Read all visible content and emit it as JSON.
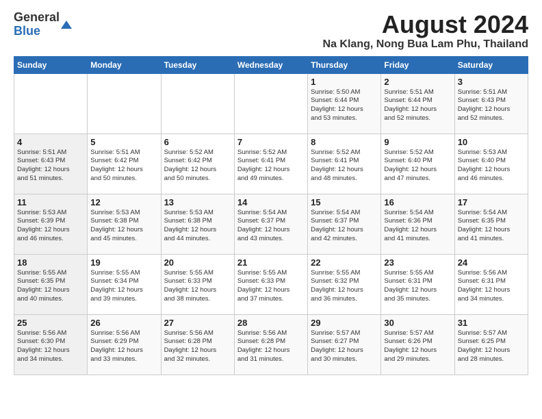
{
  "logo": {
    "general": "General",
    "blue": "Blue"
  },
  "title": "August 2024",
  "location": "Na Klang, Nong Bua Lam Phu, Thailand",
  "days_of_week": [
    "Sunday",
    "Monday",
    "Tuesday",
    "Wednesday",
    "Thursday",
    "Friday",
    "Saturday"
  ],
  "weeks": [
    [
      {
        "day": "",
        "info": ""
      },
      {
        "day": "",
        "info": ""
      },
      {
        "day": "",
        "info": ""
      },
      {
        "day": "",
        "info": ""
      },
      {
        "day": "1",
        "info": "Sunrise: 5:50 AM\nSunset: 6:44 PM\nDaylight: 12 hours\nand 53 minutes."
      },
      {
        "day": "2",
        "info": "Sunrise: 5:51 AM\nSunset: 6:44 PM\nDaylight: 12 hours\nand 52 minutes."
      },
      {
        "day": "3",
        "info": "Sunrise: 5:51 AM\nSunset: 6:43 PM\nDaylight: 12 hours\nand 52 minutes."
      }
    ],
    [
      {
        "day": "4",
        "info": "Sunrise: 5:51 AM\nSunset: 6:43 PM\nDaylight: 12 hours\nand 51 minutes."
      },
      {
        "day": "5",
        "info": "Sunrise: 5:51 AM\nSunset: 6:42 PM\nDaylight: 12 hours\nand 50 minutes."
      },
      {
        "day": "6",
        "info": "Sunrise: 5:52 AM\nSunset: 6:42 PM\nDaylight: 12 hours\nand 50 minutes."
      },
      {
        "day": "7",
        "info": "Sunrise: 5:52 AM\nSunset: 6:41 PM\nDaylight: 12 hours\nand 49 minutes."
      },
      {
        "day": "8",
        "info": "Sunrise: 5:52 AM\nSunset: 6:41 PM\nDaylight: 12 hours\nand 48 minutes."
      },
      {
        "day": "9",
        "info": "Sunrise: 5:52 AM\nSunset: 6:40 PM\nDaylight: 12 hours\nand 47 minutes."
      },
      {
        "day": "10",
        "info": "Sunrise: 5:53 AM\nSunset: 6:40 PM\nDaylight: 12 hours\nand 46 minutes."
      }
    ],
    [
      {
        "day": "11",
        "info": "Sunrise: 5:53 AM\nSunset: 6:39 PM\nDaylight: 12 hours\nand 46 minutes."
      },
      {
        "day": "12",
        "info": "Sunrise: 5:53 AM\nSunset: 6:38 PM\nDaylight: 12 hours\nand 45 minutes."
      },
      {
        "day": "13",
        "info": "Sunrise: 5:53 AM\nSunset: 6:38 PM\nDaylight: 12 hours\nand 44 minutes."
      },
      {
        "day": "14",
        "info": "Sunrise: 5:54 AM\nSunset: 6:37 PM\nDaylight: 12 hours\nand 43 minutes."
      },
      {
        "day": "15",
        "info": "Sunrise: 5:54 AM\nSunset: 6:37 PM\nDaylight: 12 hours\nand 42 minutes."
      },
      {
        "day": "16",
        "info": "Sunrise: 5:54 AM\nSunset: 6:36 PM\nDaylight: 12 hours\nand 41 minutes."
      },
      {
        "day": "17",
        "info": "Sunrise: 5:54 AM\nSunset: 6:35 PM\nDaylight: 12 hours\nand 41 minutes."
      }
    ],
    [
      {
        "day": "18",
        "info": "Sunrise: 5:55 AM\nSunset: 6:35 PM\nDaylight: 12 hours\nand 40 minutes."
      },
      {
        "day": "19",
        "info": "Sunrise: 5:55 AM\nSunset: 6:34 PM\nDaylight: 12 hours\nand 39 minutes."
      },
      {
        "day": "20",
        "info": "Sunrise: 5:55 AM\nSunset: 6:33 PM\nDaylight: 12 hours\nand 38 minutes."
      },
      {
        "day": "21",
        "info": "Sunrise: 5:55 AM\nSunset: 6:33 PM\nDaylight: 12 hours\nand 37 minutes."
      },
      {
        "day": "22",
        "info": "Sunrise: 5:55 AM\nSunset: 6:32 PM\nDaylight: 12 hours\nand 36 minutes."
      },
      {
        "day": "23",
        "info": "Sunrise: 5:55 AM\nSunset: 6:31 PM\nDaylight: 12 hours\nand 35 minutes."
      },
      {
        "day": "24",
        "info": "Sunrise: 5:56 AM\nSunset: 6:31 PM\nDaylight: 12 hours\nand 34 minutes."
      }
    ],
    [
      {
        "day": "25",
        "info": "Sunrise: 5:56 AM\nSunset: 6:30 PM\nDaylight: 12 hours\nand 34 minutes."
      },
      {
        "day": "26",
        "info": "Sunrise: 5:56 AM\nSunset: 6:29 PM\nDaylight: 12 hours\nand 33 minutes."
      },
      {
        "day": "27",
        "info": "Sunrise: 5:56 AM\nSunset: 6:28 PM\nDaylight: 12 hours\nand 32 minutes."
      },
      {
        "day": "28",
        "info": "Sunrise: 5:56 AM\nSunset: 6:28 PM\nDaylight: 12 hours\nand 31 minutes."
      },
      {
        "day": "29",
        "info": "Sunrise: 5:57 AM\nSunset: 6:27 PM\nDaylight: 12 hours\nand 30 minutes."
      },
      {
        "day": "30",
        "info": "Sunrise: 5:57 AM\nSunset: 6:26 PM\nDaylight: 12 hours\nand 29 minutes."
      },
      {
        "day": "31",
        "info": "Sunrise: 5:57 AM\nSunset: 6:25 PM\nDaylight: 12 hours\nand 28 minutes."
      }
    ]
  ]
}
